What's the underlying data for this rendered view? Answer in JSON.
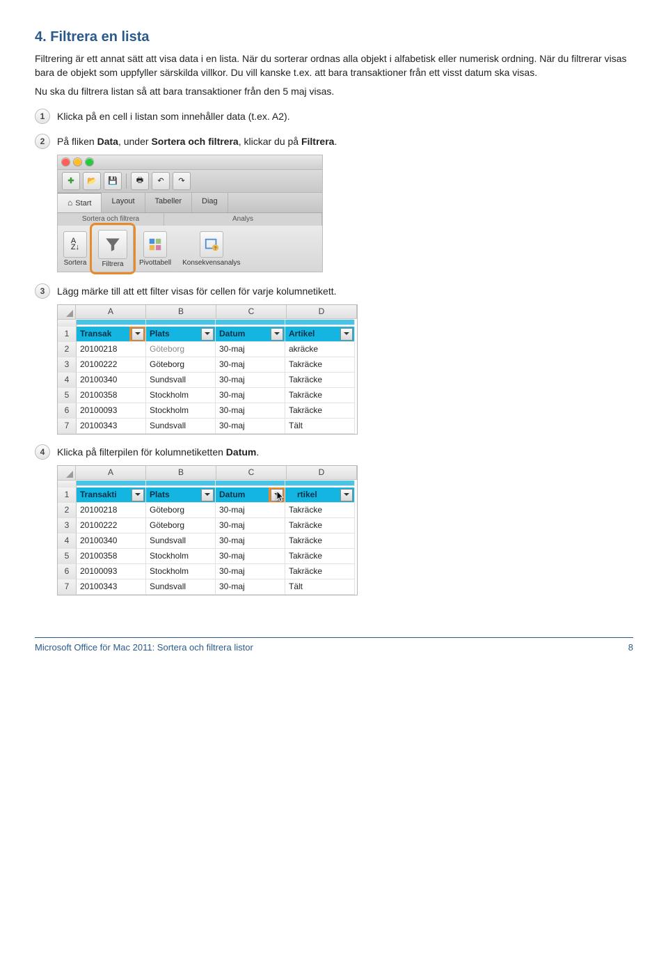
{
  "title": "4. Filtrera en lista",
  "intro": [
    "Filtrering är ett annat sätt att visa data i en lista. När du sorterar ordnas alla objekt i alfabetisk eller numerisk ordning. När du filtrerar visas bara de objekt som uppfyller särskilda villkor. Du vill kanske t.ex. att bara transaktioner från ett visst datum ska visas.",
    "Nu ska du filtrera listan så att bara transaktioner från den 5 maj visas."
  ],
  "steps": {
    "s1": {
      "num": "1",
      "text": "Klicka på en cell i listan som innehåller data (t.ex. A2)."
    },
    "s2": {
      "num": "2",
      "pre": "På fliken ",
      "b1": "Data",
      "mid": ", under ",
      "b2": "Sortera och filtrera",
      "mid2": ", klickar du på ",
      "b3": "Filtrera",
      "post": "."
    },
    "s3": {
      "num": "3",
      "text": "Lägg märke till att ett filter visas för cellen för varje kolumnetikett."
    },
    "s4": {
      "num": "4",
      "pre": "Klicka på filterpilen för kolumnetiketten ",
      "b1": "Datum",
      "post": "."
    }
  },
  "ribbon": {
    "tabs": {
      "start": "Start",
      "layout": "Layout",
      "tabeller": "Tabeller",
      "diag": "Diag"
    },
    "group_sort": "Sortera och filtrera",
    "group_analys": "Analys",
    "sort": "Sortera",
    "filter": "Filtrera",
    "pivot": "Pivottabell",
    "whatif": "Konsekvensanalys"
  },
  "sheet": {
    "cols": [
      "A",
      "B",
      "C",
      "D"
    ],
    "headers": {
      "a": "Transakti",
      "b": "Plats",
      "c": "Datum",
      "d": "Artikel"
    },
    "headers_cut": {
      "a": "Transak",
      "d_cut": "akräcke"
    },
    "rows": [
      {
        "n": "2",
        "a": "20100218",
        "b": "Göteborg",
        "c": "30-maj",
        "d": "Takräcke"
      },
      {
        "n": "3",
        "a": "20100222",
        "b": "Göteborg",
        "c": "30-maj",
        "d": "Takräcke"
      },
      {
        "n": "4",
        "a": "20100340",
        "b": "Sundsvall",
        "c": "30-maj",
        "d": "Takräcke"
      },
      {
        "n": "5",
        "a": "20100358",
        "b": "Stockholm",
        "c": "30-maj",
        "d": "Takräcke"
      },
      {
        "n": "6",
        "a": "20100093",
        "b": "Stockholm",
        "c": "30-maj",
        "d": "Takräcke"
      },
      {
        "n": "7",
        "a": "20100343",
        "b": "Sundsvall",
        "c": "30-maj",
        "d": "Tält"
      }
    ]
  },
  "footer": {
    "left": "Microsoft Office för Mac 2011: Sortera och filtrera listor",
    "right": "8"
  }
}
